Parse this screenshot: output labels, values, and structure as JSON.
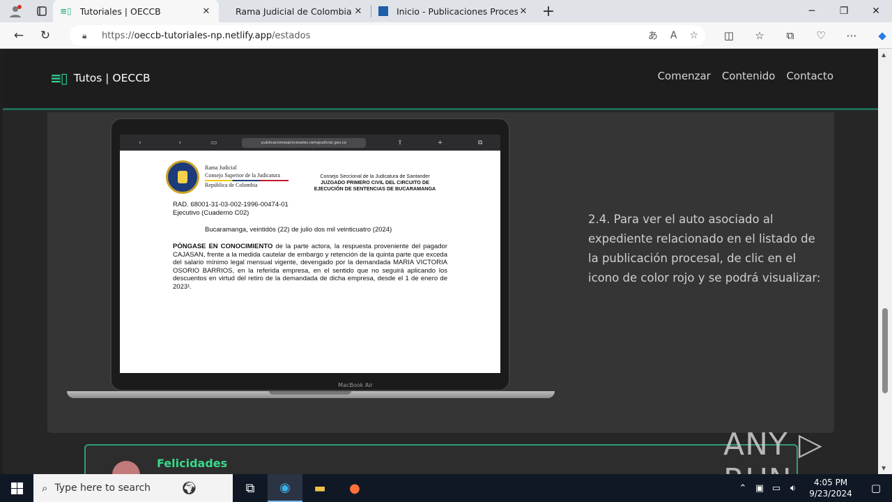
{
  "browser": {
    "tabs": [
      {
        "title": "Tutoriales | OECCB",
        "active": true
      },
      {
        "title": "Rama Judicial de Colombia: Infor",
        "active": false
      },
      {
        "title": "Inicio - Publicaciones Procesales",
        "active": false
      }
    ],
    "url_host": "oeccb-tutoriales-np.netlify.app",
    "url_prefix": "https://",
    "url_path": "/estados"
  },
  "site": {
    "logo_text": "Tutos | OECCB",
    "nav": [
      "Comenzar",
      "Contenido",
      "Contacto"
    ]
  },
  "laptop": {
    "safari_url": "publicacionesprocesales.ramajudicial.gov.co",
    "model": "MacBook Air",
    "doc": {
      "org_lines": [
        "Rama Judicial",
        "Consejo Superior de la Judicatura",
        "República de Colombia"
      ],
      "court_lines": [
        "Consejo Seccional de la Judicatura de Santander",
        "JUZGADO PRIMERO CIVIL DEL CIRCUITO DE",
        "EJECUCIÓN DE SENTENCIAS DE BUCARAMANGA"
      ],
      "rad": "RAD. 68001-31-03-002-1996-00474-01",
      "proc": "Ejecutivo (Cuaderno C02)",
      "date": "Bucaramanga, veintidós (22) de julio dos mil veinticuatro (2024)",
      "lead": "PÓNGASE EN CONOCIMIENTO",
      "body": " de la parte actora, la respuesta proveniente del pagador CAJASAN, frente a la medida cautelar de embargo y retención de la quinta parte que exceda del salario mínimo legal mensual vigente, devengado por la demandada MARIA VICTORIA OSORIO BARRIOS, en la referida empresa, en el sentido que no seguirá aplicando los descuentos en virtud del retiro de la demandada de dicha empresa, desde el 1 de enero de 2023¹."
    }
  },
  "content": {
    "instruction": "2.4. Para ver el auto asociado al expediente relacionado en el listado de la publicación procesal, de clic en el icono de color rojo y se podrá visualizar:",
    "next_card_title": "Felicidades"
  },
  "watermark": "ANY ▷ RUN",
  "taskbar": {
    "search_placeholder": "Type here to search",
    "time": "4:05 PM",
    "date": "9/23/2024"
  }
}
